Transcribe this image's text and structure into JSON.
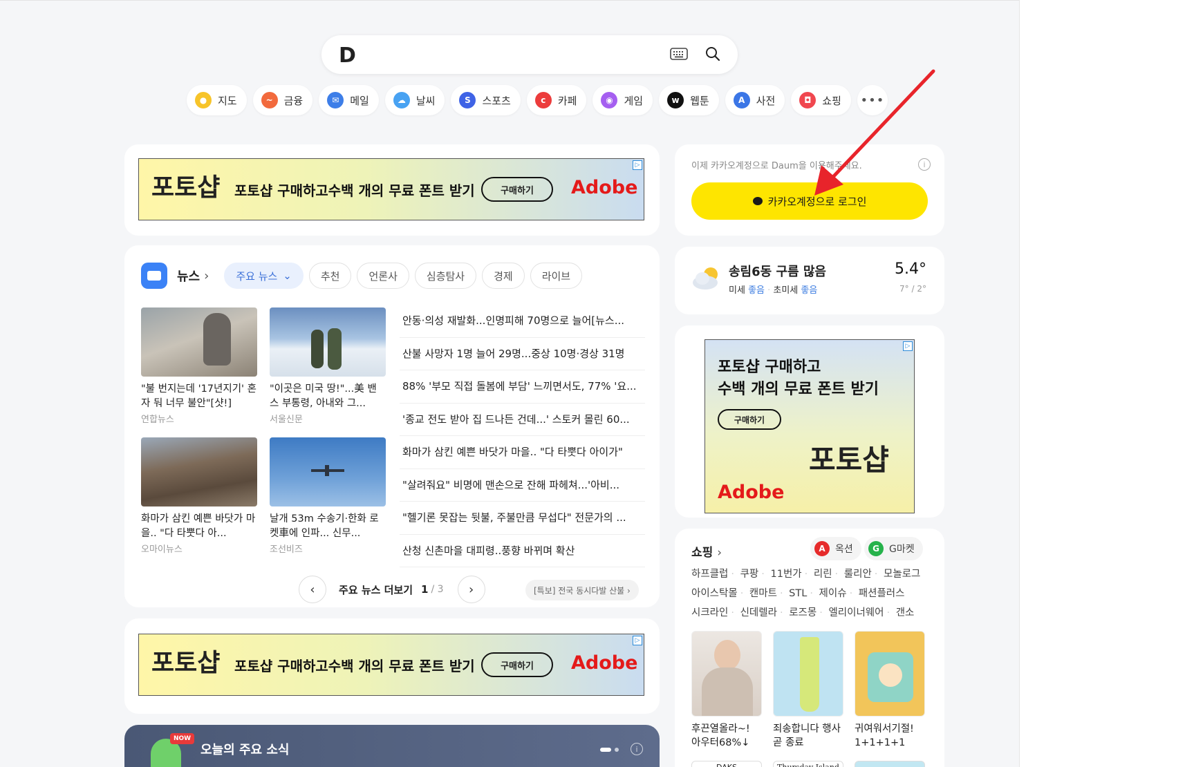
{
  "search": {
    "logo": "D"
  },
  "shortcuts": [
    {
      "label": "지도",
      "color": "#2c9b4b",
      "icon": "map-pin-icon"
    },
    {
      "label": "금융",
      "color": "#f26a3d",
      "icon": "chart-icon"
    },
    {
      "label": "메일",
      "color": "#3d7ee8",
      "icon": "mail-icon"
    },
    {
      "label": "날씨",
      "color": "#48a2f2",
      "icon": "cloud-icon"
    },
    {
      "label": "스포츠",
      "color": "#3f63e6",
      "icon": "sports-icon"
    },
    {
      "label": "카페",
      "color": "#ec3c3c",
      "icon": "cafe-icon"
    },
    {
      "label": "게임",
      "color": "#a55ff0",
      "icon": "gamepad-icon"
    },
    {
      "label": "웹툰",
      "color": "#111111",
      "icon": "webtoon-icon"
    },
    {
      "label": "사전",
      "color": "#3b76e6",
      "icon": "dictionary-icon"
    },
    {
      "label": "쇼핑",
      "color": "#f0474f",
      "icon": "shopping-icon"
    }
  ],
  "ad_banner": {
    "logo": "포토샵",
    "text": "포토샵 구매하고수백 개의 무료 폰트 받기",
    "button": "구매하기",
    "brand": "Adobe"
  },
  "news": {
    "title": "뉴스",
    "tabs": [
      "주요 뉴스",
      "추천",
      "언론사",
      "심층탐사",
      "경제",
      "라이브"
    ],
    "thumbs": [
      {
        "caption": "\"불 번지는데 '17년지기' 혼자 둬 너무 불안\"[샷!]",
        "source": "연합뉴스"
      },
      {
        "caption": "\"이곳은 미국 땅!\"...美 밴스 부통령, 아내와 그...",
        "source": "서울신문"
      },
      {
        "caption": "화마가 삼킨 예쁜 바닷가 마을.. \"다 타뿟다 아...",
        "source": "오마이뉴스"
      },
      {
        "caption": "날개 53m 수송기·한화 로켓車에 인파... 신무...",
        "source": "조선비즈"
      }
    ],
    "headlines": [
      "안동·의성 재발화...인명피해 70명으로 늘어[뉴스...",
      "산불 사망자 1명 늘어 29명...중상 10명·경상 31명",
      "88% '부모 직접 돌봄에 부담' 느끼면서도, 77% '요...",
      "'종교 전도 받아 집 드나든 건데...' 스토커 몰린 60...",
      "화마가 삼킨 예쁜 바닷가 마을.. \"다 타뿟다 아이가\"",
      "\"살려줘요\" 비명에 맨손으로 잔해 파헤쳐...'아비...",
      "\"헬기론 못잡는 뒷불, 주불만큼 무섭다\" 전문가의 ...",
      "산청 신촌마을 대피령..풍향 바뀌며 확산"
    ],
    "more_label": "주요 뉴스 더보기",
    "page": "1",
    "total": "/ 3",
    "breaking": "[특보] 전국 동시다발 산불 ›"
  },
  "today": {
    "title": "오늘의 주요 소식",
    "badge": "NOW"
  },
  "login": {
    "note": "이제 카카오계정으로 Daum을 이용해주세요.",
    "button": "카카오계정으로 로그인"
  },
  "weather": {
    "location": "송림6동 구름 많음",
    "dust_label": "미세",
    "dust_value": "좋음",
    "fine_dust_label": "초미세",
    "fine_dust_value": "좋음",
    "temp": "5.4°",
    "range": "7° / 2°"
  },
  "ad_side": {
    "line1": "포토샵 구매하고",
    "line2": "수백 개의 무료 폰트 받기",
    "button": "구매하기",
    "brand": "Adobe",
    "logo": "포토샵"
  },
  "shopping": {
    "title": "쇼핑",
    "partners": [
      {
        "label": "옥션",
        "mark": "A",
        "color": "#e62b2b"
      },
      {
        "label": "G마켓",
        "mark": "G",
        "color": "#26b24b"
      }
    ],
    "links": [
      [
        "하프클럽",
        "쿠팡",
        "11번가",
        "리린",
        "룰리안",
        "모놀로그"
      ],
      [
        "아이스탁몰",
        "캔마트",
        "STL",
        "제이슈",
        "패션플러스"
      ],
      [
        "시크라인",
        "신데렐라",
        "로즈몽",
        "엘리이너웨어",
        "갠소"
      ]
    ],
    "products": [
      {
        "caption": "후끈열올라~! 아우터68%↓"
      },
      {
        "caption": "죄송합니다 행사 곧 종료"
      },
      {
        "caption": "귀여워서기절! 1+1+1+1"
      }
    ],
    "more_products": [
      "DAKS",
      "Thursday Island",
      ""
    ]
  }
}
